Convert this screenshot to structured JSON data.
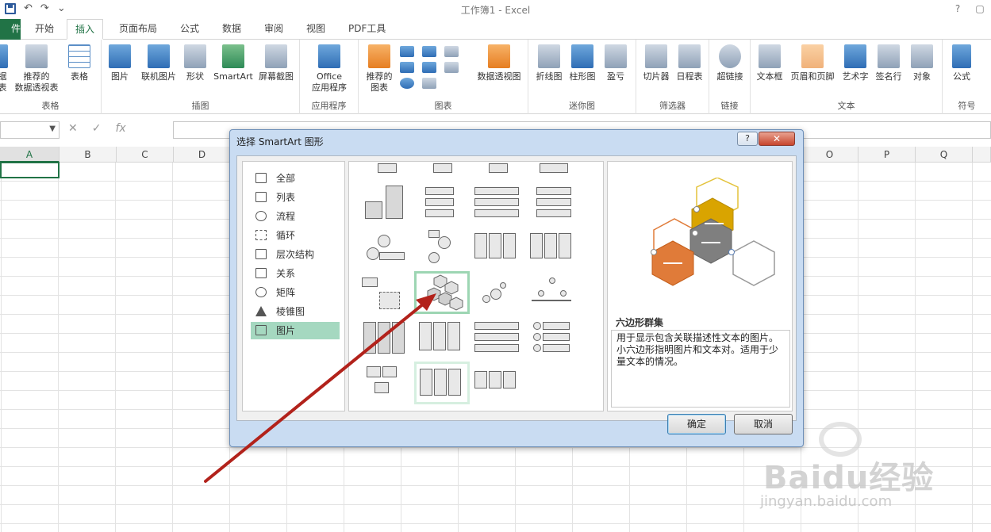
{
  "window": {
    "title": "工作簿1 - Excel",
    "help": "?",
    "min": "—",
    "max": "▢",
    "close": "✕"
  },
  "qat": {
    "undo": "↶",
    "redo": "↷",
    "more": "⌄"
  },
  "tabs": [
    {
      "label": "件"
    },
    {
      "label": "开始"
    },
    {
      "label": "插入"
    },
    {
      "label": "页面布局"
    },
    {
      "label": "公式"
    },
    {
      "label": "数据"
    },
    {
      "label": "审阅"
    },
    {
      "label": "视图"
    },
    {
      "label": "PDF工具"
    }
  ],
  "ribbon": {
    "groups": [
      {
        "label": "表格",
        "buttons": [
          {
            "label": "据\n表"
          },
          {
            "label": "推荐的\n数据透视表"
          },
          {
            "label": "表格"
          }
        ]
      },
      {
        "label": "插图",
        "buttons": [
          {
            "label": "图片"
          },
          {
            "label": "联机图片"
          },
          {
            "label": "形状"
          },
          {
            "label": "SmartArt"
          },
          {
            "label": "屏幕截图"
          }
        ]
      },
      {
        "label": "应用程序",
        "buttons": [
          {
            "label": "Office\n应用程序"
          }
        ]
      },
      {
        "label": "图表",
        "buttons": [
          {
            "label": "推荐的\n图表"
          },
          {
            "label": "数据透视图"
          }
        ]
      },
      {
        "label": "迷你图",
        "buttons": [
          {
            "label": "折线图"
          },
          {
            "label": "柱形图"
          },
          {
            "label": "盈亏"
          }
        ]
      },
      {
        "label": "筛选器",
        "buttons": [
          {
            "label": "切片器"
          },
          {
            "label": "日程表"
          }
        ]
      },
      {
        "label": "链接",
        "buttons": [
          {
            "label": "超链接"
          }
        ]
      },
      {
        "label": "文本",
        "buttons": [
          {
            "label": "文本框"
          },
          {
            "label": "页眉和页脚"
          },
          {
            "label": "艺术字"
          },
          {
            "label": "签名行"
          },
          {
            "label": "对象"
          }
        ]
      },
      {
        "label": "符号",
        "buttons": [
          {
            "label": "公式"
          }
        ]
      }
    ]
  },
  "formula_bar": {
    "fx": "fx",
    "cancel": "✕",
    "enter": "✓",
    "value": ""
  },
  "columns": [
    "A",
    "B",
    "C",
    "D",
    "O",
    "P",
    "Q"
  ],
  "dialog": {
    "title": "选择 SmartArt 图形",
    "help": "?",
    "close": "✕",
    "categories": [
      {
        "label": "全部",
        "icon": "all-icon"
      },
      {
        "label": "列表",
        "icon": "list-icon"
      },
      {
        "label": "流程",
        "icon": "process-icon"
      },
      {
        "label": "循环",
        "icon": "cycle-icon"
      },
      {
        "label": "层次结构",
        "icon": "hierarchy-icon"
      },
      {
        "label": "关系",
        "icon": "relationship-icon"
      },
      {
        "label": "矩阵",
        "icon": "matrix-icon"
      },
      {
        "label": "棱锥图",
        "icon": "pyramid-icon"
      },
      {
        "label": "图片",
        "icon": "picture-icon",
        "selected": true
      }
    ],
    "preview": {
      "name": "六边形群集",
      "description": "用于显示包含关联描述性文本的图片。小六边形指明图片和文本对。适用于少量文本的情况。"
    },
    "ok": "确定",
    "cancel": "取消"
  },
  "watermark": {
    "brand": "Baidu经验",
    "url": "jingyan.baidu.com"
  },
  "colors": {
    "excel_green": "#217346",
    "selection_green": "#a5d8c0",
    "arrow_red": "#b2221b"
  }
}
